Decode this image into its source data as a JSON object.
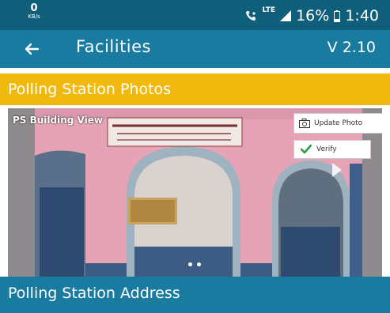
{
  "status_bar": {
    "net_speed": "0",
    "net_speed_unit": "KB/s",
    "network_type": "LTE",
    "battery": "16%",
    "time": "1:40",
    "icons": [
      "call-icon",
      "signal-icon",
      "battery-icon"
    ]
  },
  "app_bar": {
    "back_icon": "arrow-left-icon",
    "title": "Facilities",
    "version": "V 2.10"
  },
  "photos_section": {
    "header": "Polling Station Photos",
    "caption": "PS Building View",
    "update_photo_label": "Update Photo",
    "verify_label": "Verify",
    "pager": {
      "total": 2,
      "current": 1
    }
  },
  "address_section": {
    "header": "Polling Station Address"
  },
  "colors": {
    "status_bar": "#0f5f7b",
    "app_bar": "#1a7ba0",
    "photos_header": "#f1b80d",
    "verify_check": "#2a9a3a"
  }
}
